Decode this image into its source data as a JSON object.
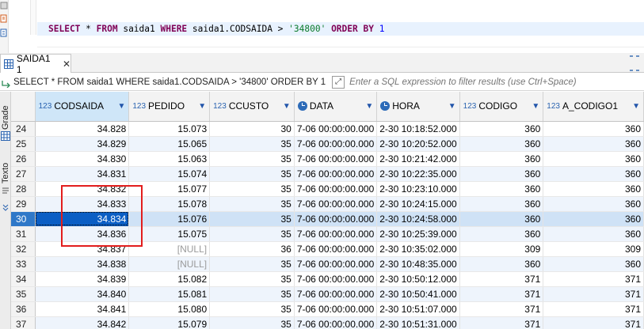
{
  "editor": {
    "sql_tokens": [
      {
        "t": "SELECT",
        "c": "kw"
      },
      {
        "t": " * ",
        "c": "op"
      },
      {
        "t": "FROM",
        "c": "kw"
      },
      {
        "t": " saida1 ",
        "c": "id"
      },
      {
        "t": "WHERE",
        "c": "kw"
      },
      {
        "t": " saida1.CODSAIDA > ",
        "c": "id"
      },
      {
        "t": "'34800'",
        "c": "str"
      },
      {
        "t": " ",
        "c": "id"
      },
      {
        "t": "ORDER BY",
        "c": "kw"
      },
      {
        "t": " ",
        "c": "id"
      },
      {
        "t": "1",
        "c": "num"
      }
    ]
  },
  "results_tab": {
    "label": "SAIDA1 1",
    "close": "✕"
  },
  "filter": {
    "query_text": "SELECT * FROM saida1 WHERE saida1.CODSAIDA > '34800' ORDER BY 1",
    "placeholder": "Enter a SQL expression to filter results (use Ctrl+Space)"
  },
  "side_tabs": {
    "grid": "Grade",
    "text": "Texto"
  },
  "columns": [
    {
      "type": "123",
      "name": "CODSAIDA",
      "sorted": true
    },
    {
      "type": "123",
      "name": "PEDIDO"
    },
    {
      "type": "123",
      "name": "CCUSTO"
    },
    {
      "type": "clock",
      "name": "DATA"
    },
    {
      "type": "clock",
      "name": "HORA"
    },
    {
      "type": "123",
      "name": "CODIGO"
    },
    {
      "type": "123",
      "name": "A_CODIGO1"
    }
  ],
  "rows": [
    {
      "n": "24",
      "cells": [
        "34.828",
        "15.073",
        "30",
        "7-06 00:00:00.000",
        "2-30 10:18:52.000",
        "360",
        "360"
      ]
    },
    {
      "n": "25",
      "cells": [
        "34.829",
        "15.065",
        "35",
        "7-06 00:00:00.000",
        "2-30 10:20:52.000",
        "360",
        "360"
      ]
    },
    {
      "n": "26",
      "cells": [
        "34.830",
        "15.063",
        "35",
        "7-06 00:00:00.000",
        "2-30 10:21:42.000",
        "360",
        "360"
      ]
    },
    {
      "n": "27",
      "cells": [
        "34.831",
        "15.074",
        "35",
        "7-06 00:00:00.000",
        "2-30 10:22:35.000",
        "360",
        "360"
      ]
    },
    {
      "n": "28",
      "cells": [
        "34.832",
        "15.077",
        "35",
        "7-06 00:00:00.000",
        "2-30 10:23:10.000",
        "360",
        "360"
      ]
    },
    {
      "n": "29",
      "cells": [
        "34.833",
        "15.078",
        "35",
        "7-06 00:00:00.000",
        "2-30 10:24:15.000",
        "360",
        "360"
      ]
    },
    {
      "n": "30",
      "cells": [
        "34.834",
        "15.076",
        "35",
        "7-06 00:00:00.000",
        "2-30 10:24:58.000",
        "360",
        "360"
      ],
      "selected": true
    },
    {
      "n": "31",
      "cells": [
        "34.836",
        "15.075",
        "35",
        "7-06 00:00:00.000",
        "2-30 10:25:39.000",
        "360",
        "360"
      ]
    },
    {
      "n": "32",
      "cells": [
        "34.837",
        "[NULL]",
        "36",
        "7-06 00:00:00.000",
        "2-30 10:35:02.000",
        "309",
        "309"
      ]
    },
    {
      "n": "33",
      "cells": [
        "34.838",
        "[NULL]",
        "35",
        "7-06 00:00:00.000",
        "2-30 10:48:35.000",
        "360",
        "360"
      ]
    },
    {
      "n": "34",
      "cells": [
        "34.839",
        "15.082",
        "35",
        "7-06 00:00:00.000",
        "2-30 10:50:12.000",
        "371",
        "371"
      ]
    },
    {
      "n": "35",
      "cells": [
        "34.840",
        "15.081",
        "35",
        "7-06 00:00:00.000",
        "2-30 10:50:41.000",
        "371",
        "371"
      ]
    },
    {
      "n": "36",
      "cells": [
        "34.841",
        "15.080",
        "35",
        "7-06 00:00:00.000",
        "2-30 10:51:07.000",
        "371",
        "371"
      ]
    },
    {
      "n": "37",
      "cells": [
        "34.842",
        "15.079",
        "35",
        "7-06 00:00:00.000",
        "2-30 10:51:31.000",
        "371",
        "371"
      ]
    }
  ],
  "colors": {
    "selection": "#0b5ec4",
    "highlight_box": "#e21d1d",
    "keyword": "#7f0055",
    "string": "#0a7a2a",
    "number": "#0000ff"
  }
}
